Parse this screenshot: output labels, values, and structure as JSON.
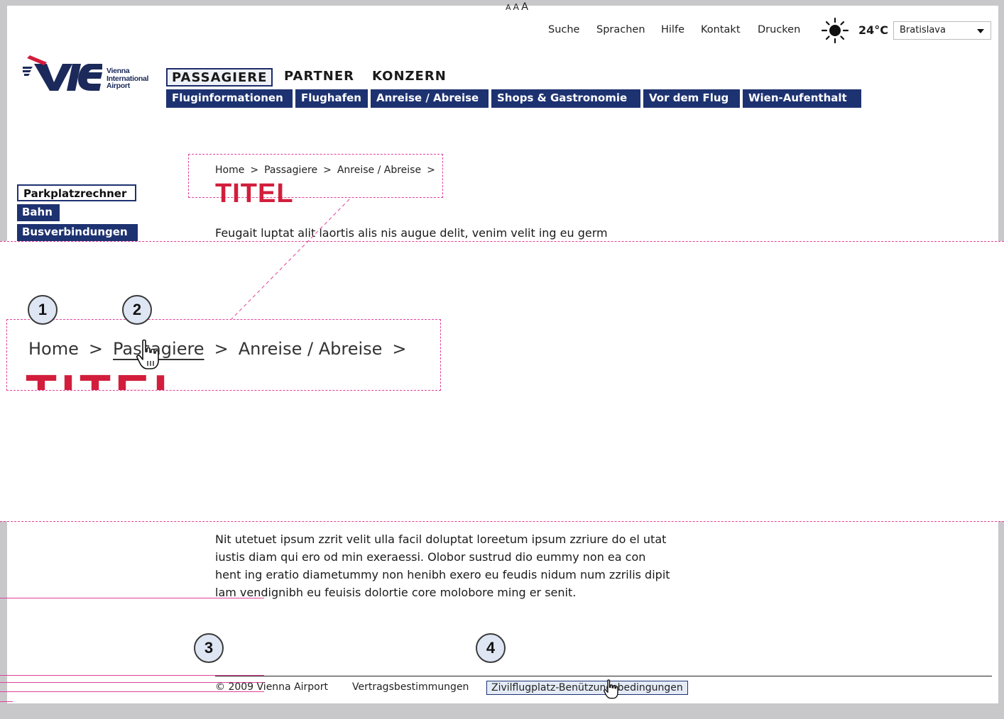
{
  "utility_nav": {
    "font_sizes": [
      "A",
      "A",
      "A"
    ],
    "links": [
      "Suche",
      "Sprachen",
      "Hilfe",
      "Kontakt",
      "Drucken"
    ]
  },
  "weather": {
    "icon": "sun-icon",
    "temperature": "24°C",
    "city": "Bratislava"
  },
  "logo": {
    "lines": [
      "Vienna",
      "International",
      "Airport"
    ]
  },
  "main_nav": [
    "PASSAGIERE",
    "PARTNER",
    "KONZERN"
  ],
  "sub_nav": [
    "Fluginformationen",
    "Flughafen",
    "Anreise / Abreise",
    "Shops & Gastronomie",
    "Vor dem Flug",
    "Wien-Aufenthalt"
  ],
  "side_nav": [
    "Parkplatzrechner",
    "Bahn",
    "Busverbindungen"
  ],
  "breadcrumb": {
    "items": [
      "Home",
      ">",
      "Passagiere",
      ">",
      "Anreise / Abreise",
      ">"
    ]
  },
  "page_title": "TITEL",
  "intro_text": "Feugait luptat alit laortis alis nis augue delit, venim velit ing eu germ",
  "paragraph": [
    "Nit utetuet ipsum zzrit velit ulla facil doluptat loreetum ipsum zzriure do el utat",
    "iustis diam qui ero od min exeraessi. Olobor sustrud dio eummy non ea con",
    "hent ing eratio diametummy non henibh exero eu feudis nidum num zzrilis dipit",
    "lam vendignibh eu feuisis dolortie core molobore ming er senit."
  ],
  "markers": [
    "1",
    "2",
    "3",
    "4"
  ],
  "footer": {
    "copyright": "© 2009 Vienna Airport",
    "links": [
      "Vertragsbestimmungen",
      "Zivilflugplatz-Benützungsbedingungen"
    ]
  },
  "colors": {
    "navy": "#1d3270",
    "title_red": "#d21e3c",
    "annotation_pink": "#e0409a",
    "frame_gray": "#c8c8cb"
  }
}
